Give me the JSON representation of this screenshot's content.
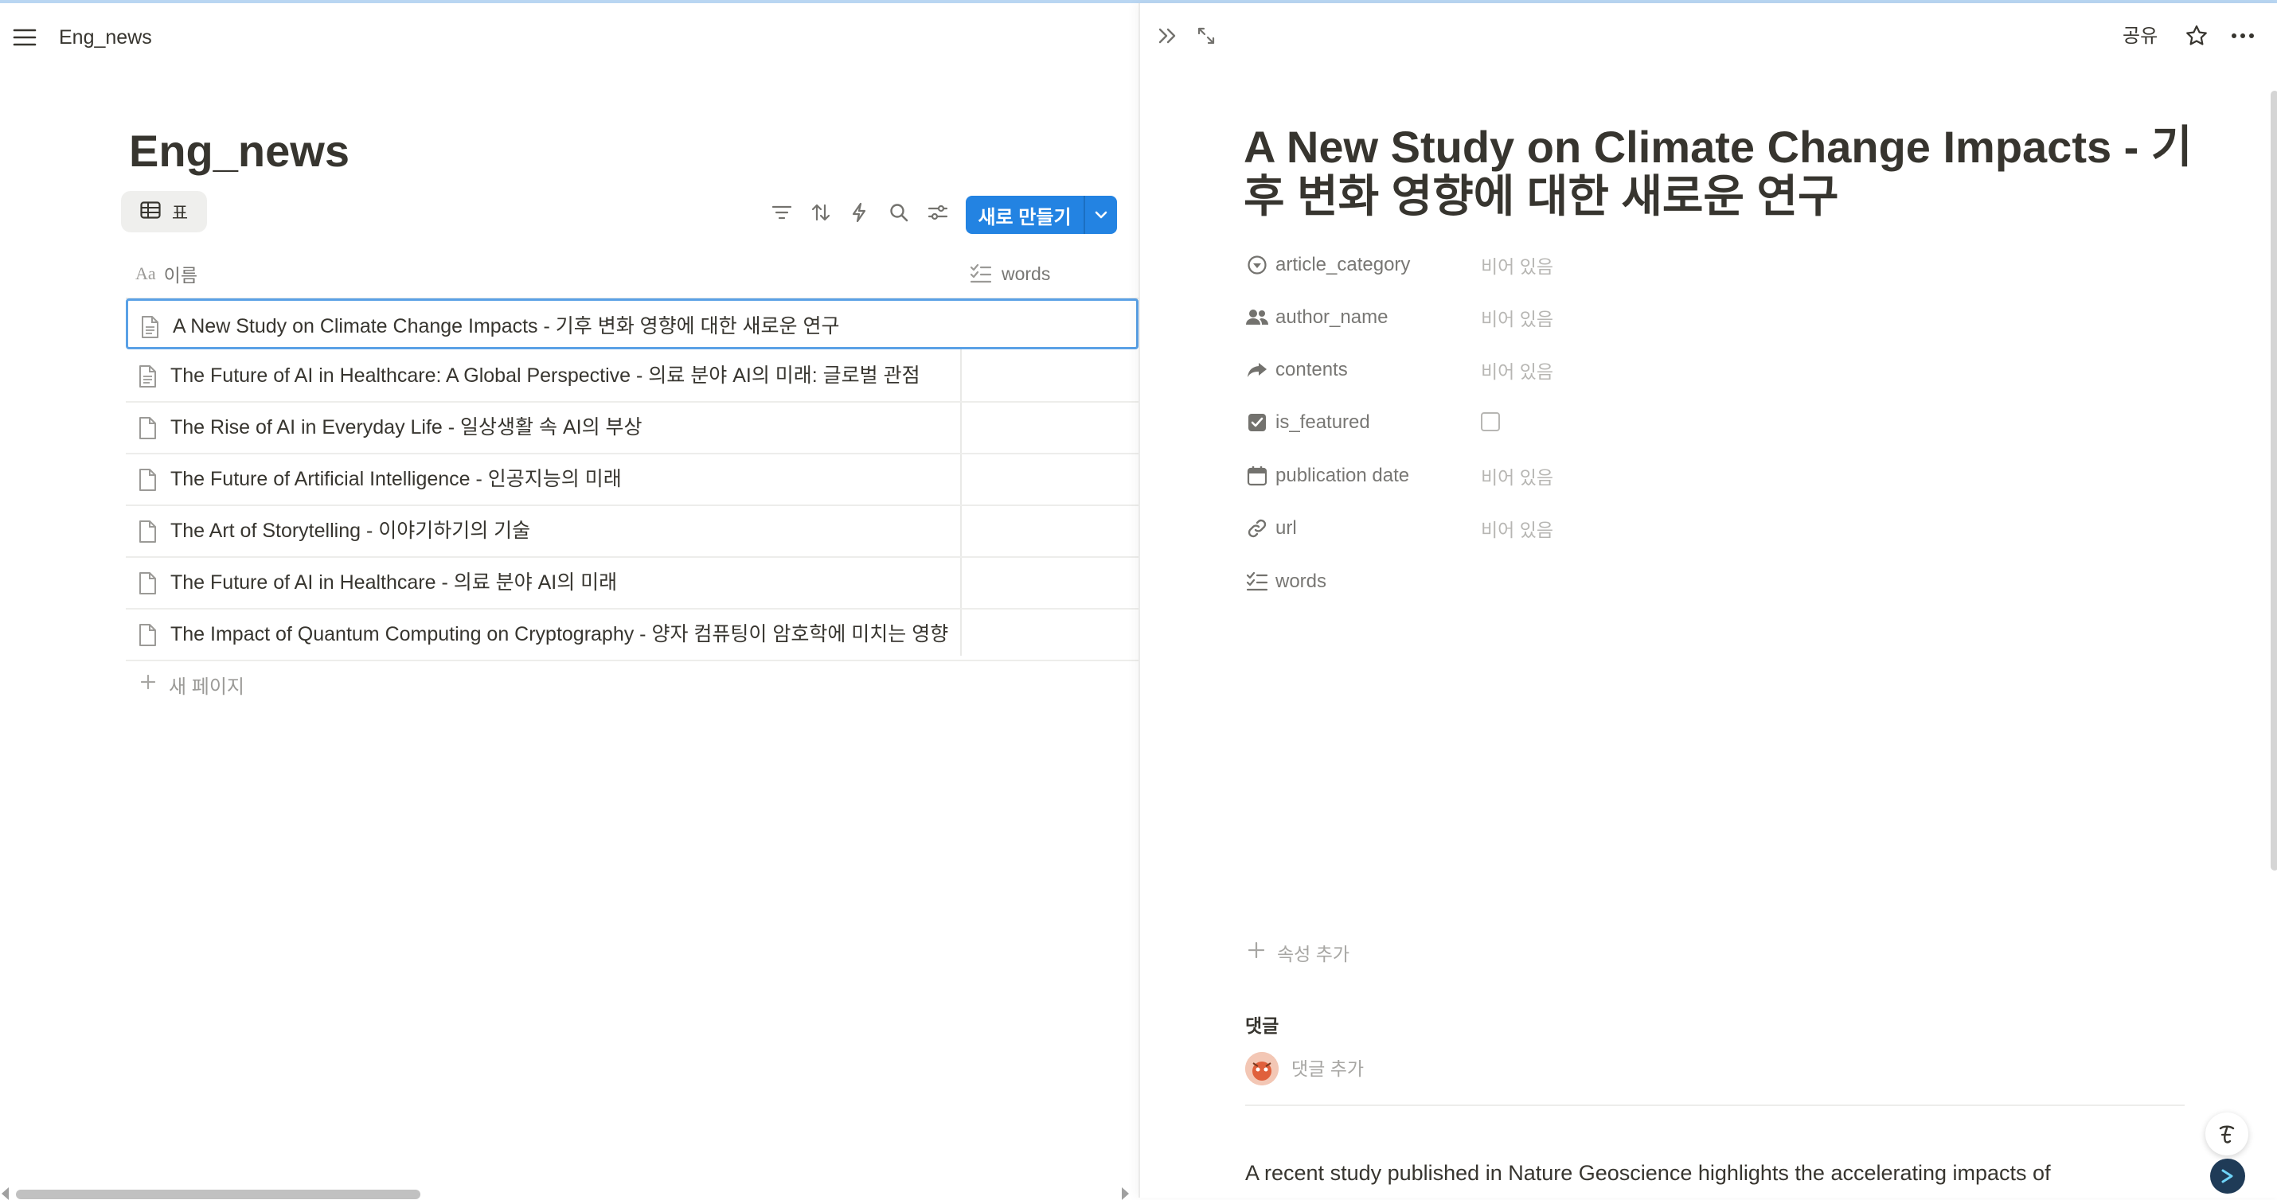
{
  "topbar": {
    "breadcrumb": "Eng_news"
  },
  "database": {
    "title": "Eng_news",
    "view_tab_label": "표",
    "new_button_label": "새로 만들기",
    "columns": {
      "name": "이름",
      "words": "words"
    },
    "rows": [
      "A New Study on Climate Change Impacts - 기후 변화 영향에 대한 새로운 연구",
      "The Future of AI in Healthcare: A Global Perspective - 의료 분야 AI의 미래: 글로벌 관점",
      "The Rise of AI in Everyday Life - 일상생활 속 AI의 부상",
      "The Future of Artificial Intelligence - 인공지능의 미래",
      "The Art of Storytelling - 이야기하기의 기술",
      "The Future of AI in Healthcare - 의료 분야 AI의 미래",
      "The Impact of Quantum Computing on Cryptography - 양자 컴퓨팅이 암호학에 미치는 영향"
    ],
    "new_page_label": "새 페이지"
  },
  "detail": {
    "share_label": "공유",
    "title": "A New Study on Climate Change Impacts - 기후 변화 영향에 대한 새로운 연구",
    "properties": [
      {
        "name": "article_category",
        "value": "비어 있음",
        "icon": "status-icon"
      },
      {
        "name": "author_name",
        "value": "비어 있음",
        "icon": "people-icon"
      },
      {
        "name": "contents",
        "value": "비어 있음",
        "icon": "relation-arrow-icon"
      },
      {
        "name": "is_featured",
        "value": "",
        "icon": "checkbox-icon",
        "checked": false
      },
      {
        "name": "publication date",
        "value": "비어 있음",
        "icon": "calendar-icon"
      },
      {
        "name": "url",
        "value": "비어 있음",
        "icon": "link-icon"
      },
      {
        "name": "words",
        "value": "",
        "icon": "checklist-icon"
      }
    ],
    "add_property_label": "속성 추가",
    "comments_label": "댓글",
    "add_comment_placeholder": "댓글 추가",
    "body_text": "A recent study published in Nature Geoscience highlights the accelerating impacts of"
  },
  "colors": {
    "accent": "#2383e2",
    "selected_border": "#5aa1e6",
    "muted_text": "#787774",
    "placeholder": "#b7b6b3"
  }
}
